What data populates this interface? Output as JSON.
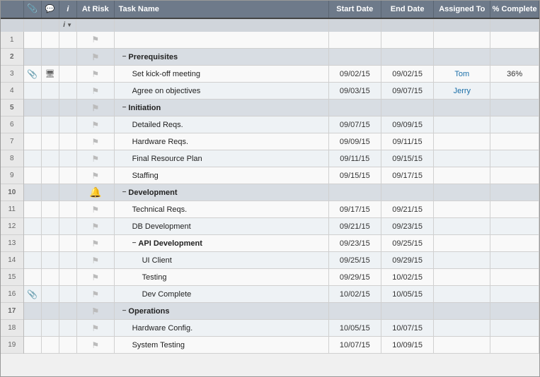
{
  "headers": {
    "row_num": "",
    "attach": "",
    "note": "",
    "info": "i",
    "at_risk": "At Risk",
    "task_name": "Task Name",
    "start_date": "Start Date",
    "end_date": "End Date",
    "assigned_to": "Assigned To",
    "pct_complete": "% Complete"
  },
  "sub_header": {
    "info_icon": "i",
    "dropdown_icon": "▼"
  },
  "rows": [
    {
      "num": "1",
      "attach": "",
      "note": "",
      "info": "",
      "at_risk": "",
      "task_name": "",
      "indent": 0,
      "group": false,
      "start": "",
      "end": "",
      "assigned": "",
      "complete": "",
      "flag": true,
      "bell": false
    },
    {
      "num": "2",
      "attach": "",
      "note": "",
      "info": "",
      "at_risk": "",
      "task_name": "Prerequisites",
      "indent": 0,
      "group": true,
      "start": "",
      "end": "",
      "assigned": "",
      "complete": "",
      "flag": true,
      "bell": false
    },
    {
      "num": "3",
      "attach": true,
      "note": true,
      "info": "",
      "at_risk": "",
      "task_name": "Set kick-off meeting",
      "indent": 1,
      "group": false,
      "start": "09/02/15",
      "end": "09/02/15",
      "assigned": "Tom",
      "complete": "36%",
      "flag": true,
      "bell": false
    },
    {
      "num": "4",
      "attach": "",
      "note": "",
      "info": "",
      "at_risk": "",
      "task_name": "Agree on objectives",
      "indent": 1,
      "group": false,
      "start": "09/03/15",
      "end": "09/07/15",
      "assigned": "Jerry",
      "complete": "",
      "flag": true,
      "bell": false
    },
    {
      "num": "5",
      "attach": "",
      "note": "",
      "info": "",
      "at_risk": "",
      "task_name": "Initiation",
      "indent": 0,
      "group": true,
      "start": "",
      "end": "",
      "assigned": "",
      "complete": "",
      "flag": true,
      "bell": false
    },
    {
      "num": "6",
      "attach": "",
      "note": "",
      "info": "",
      "at_risk": "",
      "task_name": "Detailed Reqs.",
      "indent": 1,
      "group": false,
      "start": "09/07/15",
      "end": "09/09/15",
      "assigned": "",
      "complete": "",
      "flag": true,
      "bell": false
    },
    {
      "num": "7",
      "attach": "",
      "note": "",
      "info": "",
      "at_risk": "",
      "task_name": "Hardware Reqs.",
      "indent": 1,
      "group": false,
      "start": "09/09/15",
      "end": "09/11/15",
      "assigned": "",
      "complete": "",
      "flag": true,
      "bell": false
    },
    {
      "num": "8",
      "attach": "",
      "note": "",
      "info": "",
      "at_risk": "",
      "task_name": "Final Resource Plan",
      "indent": 1,
      "group": false,
      "start": "09/11/15",
      "end": "09/15/15",
      "assigned": "",
      "complete": "",
      "flag": true,
      "bell": false
    },
    {
      "num": "9",
      "attach": "",
      "note": "",
      "info": "",
      "at_risk": "",
      "task_name": "Staffing",
      "indent": 1,
      "group": false,
      "start": "09/15/15",
      "end": "09/17/15",
      "assigned": "",
      "complete": "",
      "flag": true,
      "bell": false
    },
    {
      "num": "10",
      "attach": "",
      "note": "",
      "info": "",
      "at_risk": "",
      "task_name": "Development",
      "indent": 0,
      "group": true,
      "start": "",
      "end": "",
      "assigned": "",
      "complete": "",
      "flag": true,
      "bell": true
    },
    {
      "num": "11",
      "attach": "",
      "note": "",
      "info": "",
      "at_risk": "",
      "task_name": "Technical Reqs.",
      "indent": 1,
      "group": false,
      "start": "09/17/15",
      "end": "09/21/15",
      "assigned": "",
      "complete": "",
      "flag": true,
      "bell": false
    },
    {
      "num": "12",
      "attach": "",
      "note": "",
      "info": "",
      "at_risk": "",
      "task_name": "DB Development",
      "indent": 1,
      "group": false,
      "start": "09/21/15",
      "end": "09/23/15",
      "assigned": "",
      "complete": "",
      "flag": true,
      "bell": false
    },
    {
      "num": "13",
      "attach": "",
      "note": "",
      "info": "",
      "at_risk": "",
      "task_name": "API Development",
      "indent": 1,
      "group": true,
      "start": "09/23/15",
      "end": "09/25/15",
      "assigned": "",
      "complete": "",
      "flag": true,
      "bell": false
    },
    {
      "num": "14",
      "attach": "",
      "note": "",
      "info": "",
      "at_risk": "",
      "task_name": "UI Client",
      "indent": 2,
      "group": false,
      "start": "09/25/15",
      "end": "09/29/15",
      "assigned": "",
      "complete": "",
      "flag": true,
      "bell": false
    },
    {
      "num": "15",
      "attach": "",
      "note": "",
      "info": "",
      "at_risk": "",
      "task_name": "Testing",
      "indent": 2,
      "group": false,
      "start": "09/29/15",
      "end": "10/02/15",
      "assigned": "",
      "complete": "",
      "flag": true,
      "bell": false
    },
    {
      "num": "16",
      "attach": true,
      "note": "",
      "info": "",
      "at_risk": "",
      "task_name": "Dev Complete",
      "indent": 2,
      "group": false,
      "start": "10/02/15",
      "end": "10/05/15",
      "assigned": "",
      "complete": "",
      "flag": true,
      "bell": false
    },
    {
      "num": "17",
      "attach": "",
      "note": "",
      "info": "",
      "at_risk": "",
      "task_name": "Operations",
      "indent": 0,
      "group": true,
      "start": "",
      "end": "",
      "assigned": "",
      "complete": "",
      "flag": true,
      "bell": false
    },
    {
      "num": "18",
      "attach": "",
      "note": "",
      "info": "",
      "at_risk": "",
      "task_name": "Hardware Config.",
      "indent": 1,
      "group": false,
      "start": "10/05/15",
      "end": "10/07/15",
      "assigned": "",
      "complete": "",
      "flag": true,
      "bell": false
    },
    {
      "num": "19",
      "attach": "",
      "note": "",
      "info": "",
      "at_risk": "",
      "task_name": "System Testing",
      "indent": 1,
      "group": false,
      "start": "10/07/15",
      "end": "10/09/15",
      "assigned": "",
      "complete": "",
      "flag": true,
      "bell": false
    }
  ],
  "colors": {
    "header_bg": "#6e7a8a",
    "group_row_bg": "#d8dde3",
    "odd_row_bg": "#f9f9f9",
    "even_row_bg": "#eef2f5",
    "assigned_color": "#1a6fa8",
    "bell_color": "#e0a800"
  }
}
